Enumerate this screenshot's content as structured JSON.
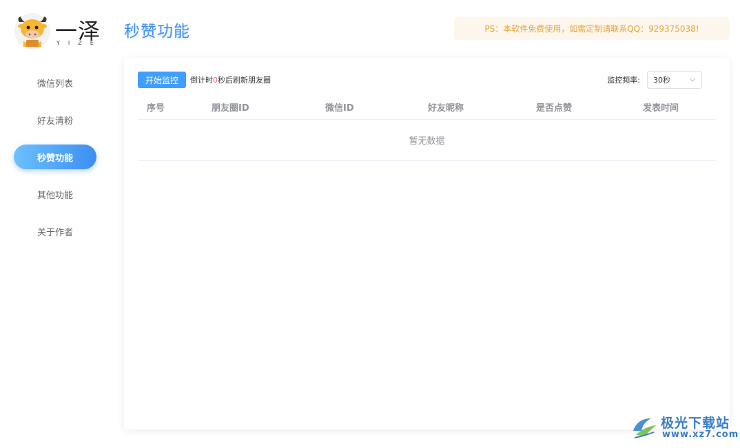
{
  "logo": {
    "name": "一泽",
    "sub": "YIZE"
  },
  "sidebar": {
    "items": [
      {
        "label": "微信列表",
        "active": false
      },
      {
        "label": "好友清粉",
        "active": false
      },
      {
        "label": "秒赞功能",
        "active": true
      },
      {
        "label": "其他功能",
        "active": false
      },
      {
        "label": "关于作者",
        "active": false
      }
    ]
  },
  "header": {
    "title": "秒赞功能",
    "notice": "PS：本软件免费使用，如需定制请联系QQ：929375038!"
  },
  "toolbar": {
    "start_label": "开始监控",
    "countdown_prefix": "倒计时",
    "countdown_value": "0",
    "countdown_suffix": "秒后刷新朋友圈",
    "freq_label": "监控频率:",
    "freq_value": "30秒"
  },
  "table": {
    "columns": [
      "序号",
      "朋友圈ID",
      "微信ID",
      "好友昵称",
      "是否点赞",
      "发表时间"
    ],
    "rows": [],
    "empty_text": "暂无数据"
  },
  "watermark": {
    "title": "极光下载站",
    "url": "www.xz7.com"
  },
  "colors": {
    "accent": "#409eff",
    "title": "#3d8ff5",
    "notice_text": "#e6a23c",
    "notice_bg": "#fdf6ec",
    "countdown_num": "#f56c6c"
  }
}
